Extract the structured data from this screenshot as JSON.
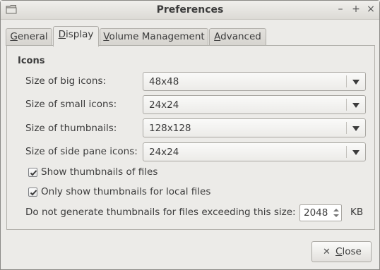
{
  "window": {
    "title": "Preferences",
    "buttons": {
      "minimize": "–",
      "maximize": "+",
      "close": "×"
    }
  },
  "tabs": [
    {
      "label": "General",
      "mnemonic": "G",
      "rest": "eneral"
    },
    {
      "label": "Display",
      "mnemonic": "D",
      "rest": "isplay",
      "active": true
    },
    {
      "label": "Volume Management",
      "mnemonic": "V",
      "rest": "olume Management"
    },
    {
      "label": "Advanced",
      "mnemonic": "A",
      "rest": "dvanced"
    }
  ],
  "icons_section": {
    "title": "Icons",
    "rows": [
      {
        "label": "Size of big icons:",
        "value": "48x48"
      },
      {
        "label": "Size of small icons:",
        "value": "24x24"
      },
      {
        "label": "Size of thumbnails:",
        "value": "128x128"
      },
      {
        "label": "Size of side pane icons:",
        "value": "24x24"
      }
    ],
    "checkboxes": [
      {
        "label": "Show thumbnails of files",
        "checked": true
      },
      {
        "label": "Only show thumbnails for local files",
        "checked": true
      }
    ],
    "threshold": {
      "label": "Do not generate thumbnails for files exceeding this size:",
      "value": "2048",
      "unit": "KB"
    }
  },
  "footer": {
    "close_label_mnemonic": "C",
    "close_label_rest": "lose",
    "close_label": "Close"
  }
}
